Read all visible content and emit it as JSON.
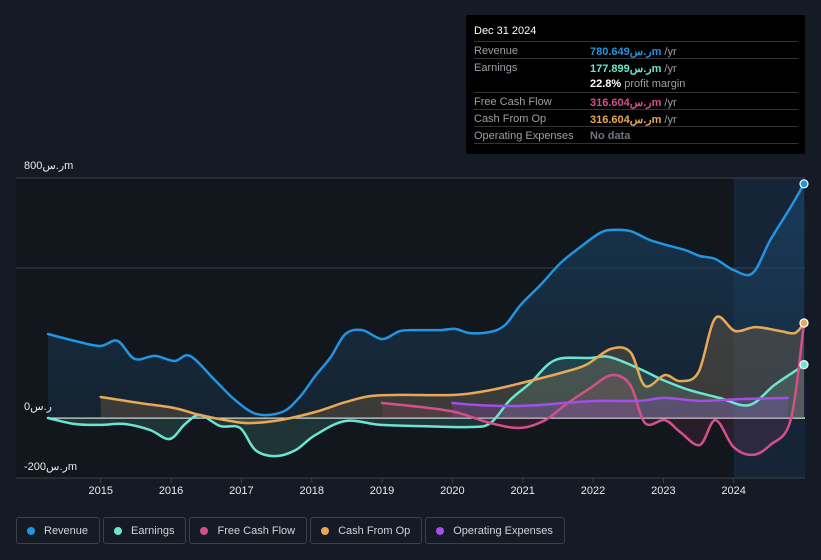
{
  "tooltip": {
    "date": "Dec 31 2024",
    "rows": [
      {
        "label": "Revenue",
        "value": "780.649ر.سm",
        "unit": " /yr",
        "color": "#2394df"
      },
      {
        "label": "Earnings",
        "value": "177.899ر.سm",
        "unit": " /yr",
        "color": "#6ce5d0"
      },
      {
        "label": "",
        "value": "22.8%",
        "unit": " profit margin",
        "color": "#ffffff"
      },
      {
        "label": "Free Cash Flow",
        "value": "316.604ر.سm",
        "unit": " /yr",
        "color": "#d4508b"
      },
      {
        "label": "Cash From Op",
        "value": "316.604ر.سm",
        "unit": " /yr",
        "color": "#e8a956"
      },
      {
        "label": "Operating Expenses",
        "value": "No data",
        "unit": "",
        "color": "#6e757d"
      }
    ]
  },
  "legend": [
    {
      "label": "Revenue",
      "color": "#2394df"
    },
    {
      "label": "Earnings",
      "color": "#6ce5d0"
    },
    {
      "label": "Free Cash Flow",
      "color": "#d4508b"
    },
    {
      "label": "Cash From Op",
      "color": "#e8a956"
    },
    {
      "label": "Operating Expenses",
      "color": "#a24ee8"
    }
  ],
  "chart_data": {
    "type": "area",
    "title": "",
    "xlabel": "",
    "ylabel": "",
    "unit": "ر.سm",
    "ylim": [
      -200,
      800
    ],
    "xlim": [
      2014.25,
      2025.0
    ],
    "y_ticks": [
      {
        "value": 800,
        "label": "800ر.سm"
      },
      {
        "value": 0,
        "label": "0ر.س"
      },
      {
        "value": -200,
        "label": "-200ر.سm"
      }
    ],
    "x_ticks": [
      "2015",
      "2016",
      "2017",
      "2018",
      "2019",
      "2020",
      "2021",
      "2022",
      "2023",
      "2024"
    ],
    "grid": true,
    "highlight_from": 2024.0,
    "legend_position": "bottom",
    "series": [
      {
        "name": "Revenue",
        "color": "#2394df",
        "x": [
          2014.25,
          2014.63,
          2014.99,
          2015.24,
          2015.48,
          2015.77,
          2016.05,
          2016.27,
          2016.62,
          2016.91,
          2017.22,
          2017.58,
          2017.83,
          2018.05,
          2018.27,
          2018.48,
          2018.72,
          2019.0,
          2019.26,
          2019.54,
          2019.83,
          2020.04,
          2020.25,
          2020.54,
          2020.75,
          2020.97,
          2021.25,
          2021.54,
          2021.82,
          2022.1,
          2022.27,
          2022.53,
          2022.81,
          2023.1,
          2023.31,
          2023.52,
          2023.74,
          2024.0,
          2024.27,
          2024.52,
          2024.81,
          2025.0
        ],
        "values": [
          280,
          257,
          240,
          257,
          197,
          207,
          190,
          207,
          127,
          60,
          13,
          20,
          70,
          140,
          203,
          280,
          293,
          263,
          290,
          293,
          293,
          297,
          283,
          287,
          310,
          377,
          443,
          517,
          570,
          617,
          627,
          623,
          593,
          573,
          560,
          540,
          530,
          493,
          483,
          593,
          703,
          780.6
        ]
      },
      {
        "name": "Earnings",
        "color": "#6ce5d0",
        "x": [
          2014.25,
          2014.63,
          2014.99,
          2015.34,
          2015.7,
          2015.98,
          2016.2,
          2016.41,
          2016.7,
          2016.98,
          2017.2,
          2017.48,
          2017.77,
          2018.05,
          2018.48,
          2018.98,
          2019.54,
          2020.25,
          2020.54,
          2020.82,
          2021.11,
          2021.46,
          2021.96,
          2022.24,
          2022.67,
          2022.99,
          2023.37,
          2023.8,
          2024.22,
          2024.58,
          2024.94,
          2025.0
        ],
        "values": [
          0,
          -20,
          -23,
          -20,
          -40,
          -70,
          -20,
          10,
          -27,
          -33,
          -107,
          -127,
          -107,
          -57,
          -10,
          -23,
          -27,
          -30,
          -17,
          60,
          117,
          193,
          200,
          203,
          163,
          127,
          93,
          67,
          43,
          110,
          167,
          177.9
        ]
      },
      {
        "name": "Free Cash Flow",
        "color": "#d4508b",
        "x": [
          2019.0,
          2019.54,
          2020.04,
          2020.54,
          2020.97,
          2021.32,
          2021.6,
          2021.96,
          2022.27,
          2022.53,
          2022.74,
          2023.02,
          2023.24,
          2023.52,
          2023.74,
          2024.0,
          2024.27,
          2024.52,
          2024.81,
          2025.0
        ],
        "values": [
          50,
          37,
          20,
          -17,
          -33,
          -7,
          43,
          100,
          143,
          110,
          -17,
          -7,
          -47,
          -90,
          -7,
          -97,
          -123,
          -90,
          -7,
          316.6
        ]
      },
      {
        "name": "Cash From Op",
        "color": "#e8a956",
        "x": [
          2015.0,
          2015.55,
          2016.05,
          2016.41,
          2016.84,
          2017.12,
          2017.55,
          2018.05,
          2018.48,
          2018.83,
          2019.26,
          2020.04,
          2020.54,
          2021.04,
          2021.54,
          2021.9,
          2022.25,
          2022.53,
          2022.74,
          2023.02,
          2023.24,
          2023.5,
          2023.74,
          2024.02,
          2024.31,
          2024.66,
          2024.87,
          2025.0
        ],
        "values": [
          70,
          50,
          33,
          10,
          -10,
          -17,
          -7,
          20,
          53,
          73,
          77,
          77,
          93,
          120,
          150,
          177,
          230,
          220,
          107,
          143,
          123,
          153,
          333,
          290,
          303,
          290,
          283,
          316.6
        ]
      },
      {
        "name": "Operating Expenses",
        "color": "#a24ee8",
        "x": [
          2020.0,
          2020.38,
          2020.81,
          2021.23,
          2021.59,
          2022.09,
          2022.66,
          2023.02,
          2023.52,
          2024.09,
          2024.77
        ],
        "values": [
          50,
          43,
          40,
          43,
          50,
          57,
          57,
          67,
          57,
          63,
          67
        ]
      }
    ]
  }
}
